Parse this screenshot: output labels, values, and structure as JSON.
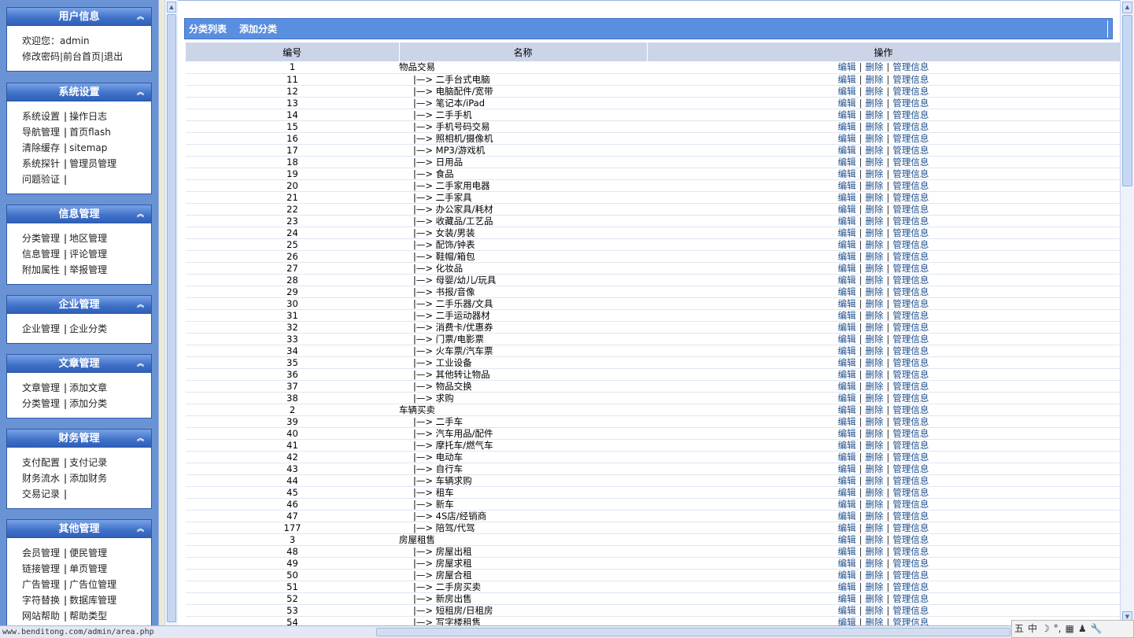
{
  "sidebar": {
    "panels": [
      {
        "title": "用户信息",
        "rows": [
          [
            "欢迎您：admin"
          ],
          [
            "修改密码|前台首页|退出"
          ]
        ]
      },
      {
        "title": "系统设置",
        "rows": [
          [
            "系统设置",
            "操作日志"
          ],
          [
            "导航管理",
            "首页flash"
          ],
          [
            "清除缓存",
            "sitemap"
          ],
          [
            "系统探针",
            "管理员管理"
          ],
          [
            "问题验证",
            ""
          ]
        ]
      },
      {
        "title": "信息管理",
        "rows": [
          [
            "分类管理",
            "地区管理"
          ],
          [
            "信息管理",
            "评论管理"
          ],
          [
            "附加属性",
            "举报管理"
          ]
        ]
      },
      {
        "title": "企业管理",
        "rows": [
          [
            "企业管理",
            "企业分类"
          ]
        ]
      },
      {
        "title": "文章管理",
        "rows": [
          [
            "文章管理",
            "添加文章"
          ],
          [
            "分类管理",
            "添加分类"
          ]
        ]
      },
      {
        "title": "财务管理",
        "rows": [
          [
            "支付配置",
            "支付记录"
          ],
          [
            "财务流水",
            "添加财务"
          ],
          [
            "交易记录",
            ""
          ]
        ]
      },
      {
        "title": "其他管理",
        "rows": [
          [
            "会员管理",
            "便民管理"
          ],
          [
            "链接管理",
            "单页管理"
          ],
          [
            "广告管理",
            "广告位管理"
          ],
          [
            "字符替换",
            "数据库管理"
          ],
          [
            "网站帮助",
            "帮助类型"
          ]
        ]
      }
    ]
  },
  "tabs": [
    "分类列表",
    "添加分类"
  ],
  "table": {
    "headers": [
      "编号",
      "名称",
      "操作"
    ],
    "ops": [
      "编辑",
      "删除",
      "管理信息"
    ],
    "rows": [
      {
        "id": "1",
        "name": "物品交易",
        "child": false
      },
      {
        "id": "11",
        "name": "|—> 二手台式电脑",
        "child": true
      },
      {
        "id": "12",
        "name": "|—> 电脑配件/宽带",
        "child": true
      },
      {
        "id": "13",
        "name": "|—> 笔记本/iPad",
        "child": true
      },
      {
        "id": "14",
        "name": "|—> 二手手机",
        "child": true
      },
      {
        "id": "15",
        "name": "|—> 手机号码交易",
        "child": true
      },
      {
        "id": "16",
        "name": "|—> 照相机/摄像机",
        "child": true
      },
      {
        "id": "17",
        "name": "|—> MP3/游戏机",
        "child": true
      },
      {
        "id": "18",
        "name": "|—> 日用品",
        "child": true
      },
      {
        "id": "19",
        "name": "|—> 食品",
        "child": true
      },
      {
        "id": "20",
        "name": "|—> 二手家用电器",
        "child": true
      },
      {
        "id": "21",
        "name": "|—> 二手家具",
        "child": true
      },
      {
        "id": "22",
        "name": "|—> 办公家具/耗材",
        "child": true
      },
      {
        "id": "23",
        "name": "|—> 收藏品/工艺品",
        "child": true
      },
      {
        "id": "24",
        "name": "|—> 女装/男装",
        "child": true
      },
      {
        "id": "25",
        "name": "|—> 配饰/钟表",
        "child": true
      },
      {
        "id": "26",
        "name": "|—> 鞋帽/箱包",
        "child": true
      },
      {
        "id": "27",
        "name": "|—> 化妆品",
        "child": true
      },
      {
        "id": "28",
        "name": "|—> 母婴/幼儿/玩具",
        "child": true
      },
      {
        "id": "29",
        "name": "|—> 书报/音像",
        "child": true
      },
      {
        "id": "30",
        "name": "|—> 二手乐器/文具",
        "child": true
      },
      {
        "id": "31",
        "name": "|—> 二手运动器材",
        "child": true
      },
      {
        "id": "32",
        "name": "|—> 消费卡/优惠券",
        "child": true
      },
      {
        "id": "33",
        "name": "|—> 门票/电影票",
        "child": true
      },
      {
        "id": "34",
        "name": "|—> 火车票/汽车票",
        "child": true
      },
      {
        "id": "35",
        "name": "|—> 工业设备",
        "child": true
      },
      {
        "id": "36",
        "name": "|—> 其他转让物品",
        "child": true
      },
      {
        "id": "37",
        "name": "|—> 物品交换",
        "child": true
      },
      {
        "id": "38",
        "name": "|—> 求购",
        "child": true
      },
      {
        "id": "2",
        "name": "车辆买卖",
        "child": false
      },
      {
        "id": "39",
        "name": "|—> 二手车",
        "child": true
      },
      {
        "id": "40",
        "name": "|—> 汽车用品/配件",
        "child": true
      },
      {
        "id": "41",
        "name": "|—> 摩托车/燃气车",
        "child": true
      },
      {
        "id": "42",
        "name": "|—> 电动车",
        "child": true
      },
      {
        "id": "43",
        "name": "|—> 自行车",
        "child": true
      },
      {
        "id": "44",
        "name": "|—> 车辆求购",
        "child": true
      },
      {
        "id": "45",
        "name": "|—> 租车",
        "child": true
      },
      {
        "id": "46",
        "name": "|—> 新车",
        "child": true
      },
      {
        "id": "47",
        "name": "|—> 4S店/经销商",
        "child": true
      },
      {
        "id": "177",
        "name": "|—> 陪驾/代驾",
        "child": true
      },
      {
        "id": "3",
        "name": "房屋租售",
        "child": false
      },
      {
        "id": "48",
        "name": "|—> 房屋出租",
        "child": true
      },
      {
        "id": "49",
        "name": "|—> 房屋求租",
        "child": true
      },
      {
        "id": "50",
        "name": "|—> 房屋合租",
        "child": true
      },
      {
        "id": "51",
        "name": "|—> 二手房买卖",
        "child": true
      },
      {
        "id": "52",
        "name": "|—> 新房出售",
        "child": true
      },
      {
        "id": "53",
        "name": "|—> 短租房/日租房",
        "child": true
      },
      {
        "id": "54",
        "name": "|—> 写字楼租售",
        "child": true
      }
    ]
  },
  "statusbar": {
    "url": "www.benditong.com/admin/area.php",
    "ime": [
      "五",
      "中",
      "☽",
      "°,",
      "▦",
      "♟",
      "🔧"
    ]
  },
  "icons": {
    "collapse": "double-chevron-up-icon"
  }
}
